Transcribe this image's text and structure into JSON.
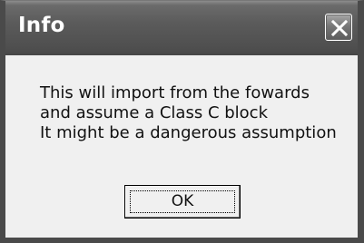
{
  "window": {
    "title": "Info",
    "close_icon": "close-icon"
  },
  "message": {
    "lines": [
      "This will import from the fowards",
      "and assume a Class C block",
      "It might be a dangerous assumption"
    ]
  },
  "buttons": {
    "ok_label": "OK"
  }
}
